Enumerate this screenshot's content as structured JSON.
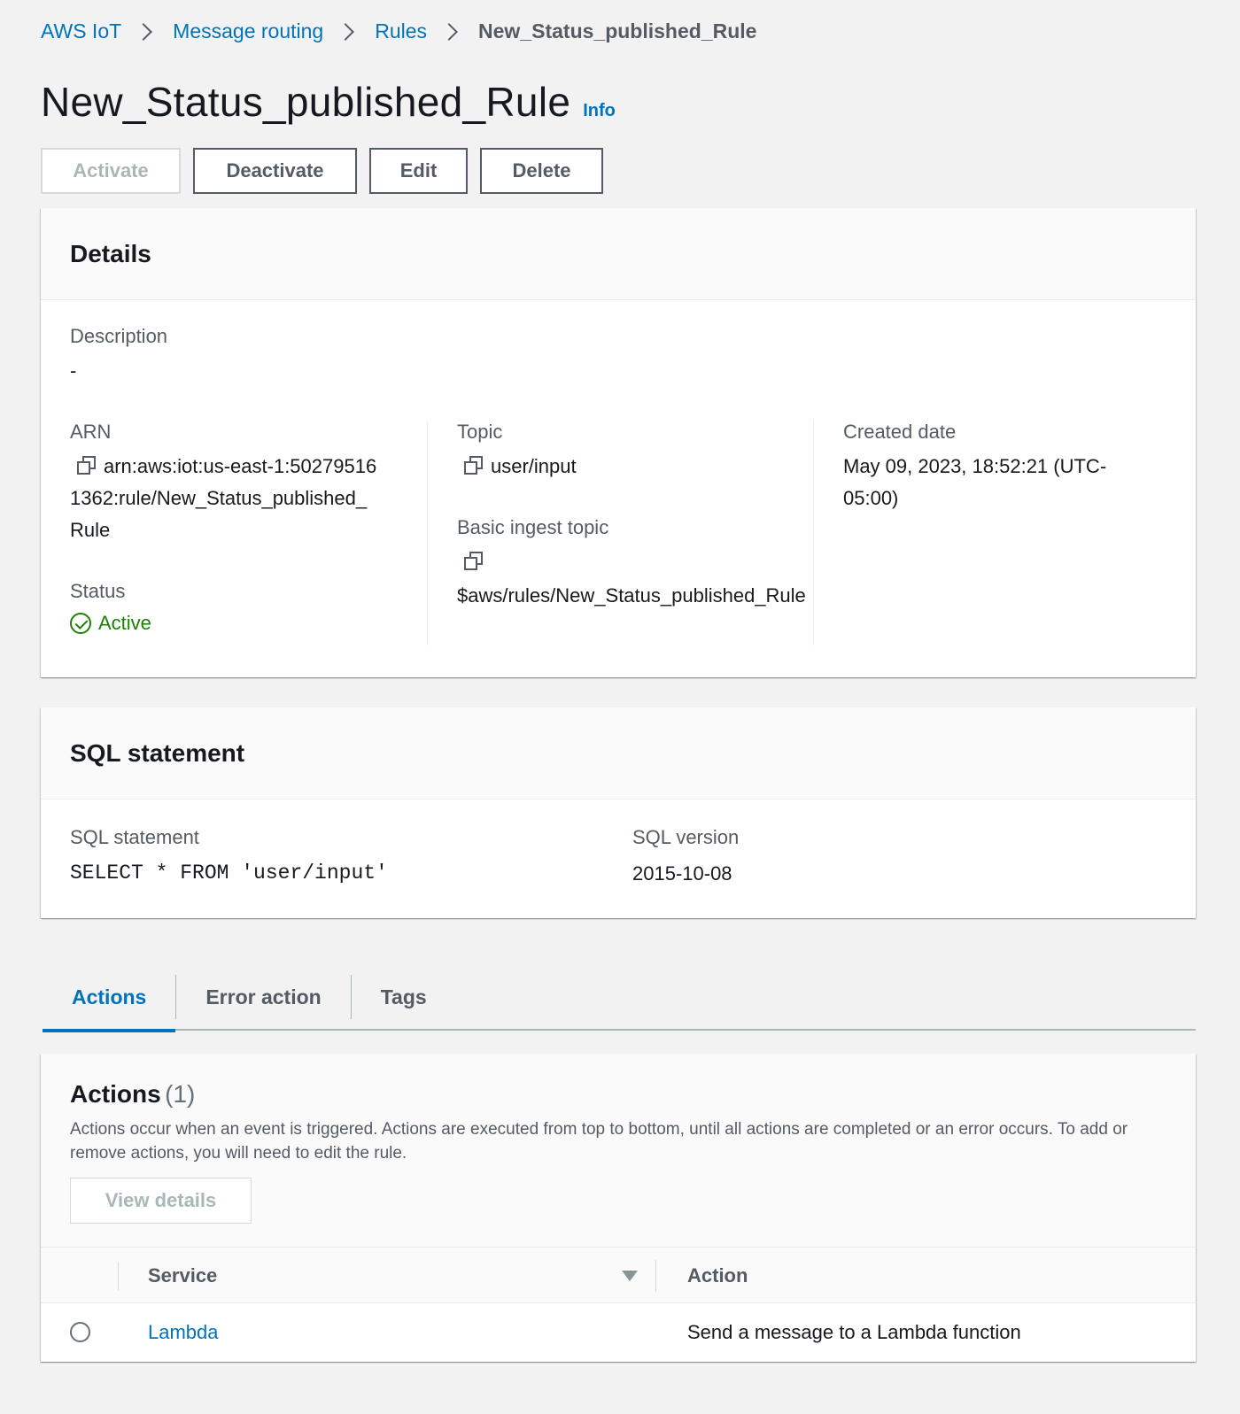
{
  "breadcrumb": {
    "items": [
      "AWS IoT",
      "Message routing",
      "Rules"
    ],
    "current": "New_Status_published_Rule"
  },
  "page": {
    "title": "New_Status_published_Rule",
    "info_label": "Info"
  },
  "buttons": {
    "activate": "Activate",
    "deactivate": "Deactivate",
    "edit": "Edit",
    "delete": "Delete"
  },
  "details": {
    "title": "Details",
    "description_label": "Description",
    "description_value": "-",
    "arn_label": "ARN",
    "arn_line1": "arn:aws:iot:us-east-1:50279516",
    "arn_line2": "1362:rule/New_Status_published_",
    "arn_line3": "Rule",
    "status_label": "Status",
    "status_value": "Active",
    "topic_label": "Topic",
    "topic_value": "user/input",
    "basic_ingest_label": "Basic ingest topic",
    "basic_ingest_value": "$aws/rules/New_Status_published_Rule",
    "created_label": "Created date",
    "created_line1": "May 09, 2023, 18:52:21 (UTC-",
    "created_line2": "05:00)"
  },
  "sql": {
    "title": "SQL statement",
    "statement_label": "SQL statement",
    "statement_value": "SELECT * FROM 'user/input'",
    "version_label": "SQL version",
    "version_value": "2015-10-08"
  },
  "tabs": [
    "Actions",
    "Error action",
    "Tags"
  ],
  "actions": {
    "title": "Actions",
    "count": "(1)",
    "description": "Actions occur when an event is triggered. Actions are executed from top to bottom, until all actions are completed or an error occurs. To add or remove actions, you will need to edit the rule.",
    "view_details": "View details",
    "columns": [
      "Service",
      "Action"
    ],
    "rows": [
      {
        "service": "Lambda",
        "action": "Send a message to a Lambda function"
      }
    ]
  },
  "colors": {
    "link": "#0073bb",
    "success": "#1d8102",
    "background": "#f2f2f2"
  }
}
